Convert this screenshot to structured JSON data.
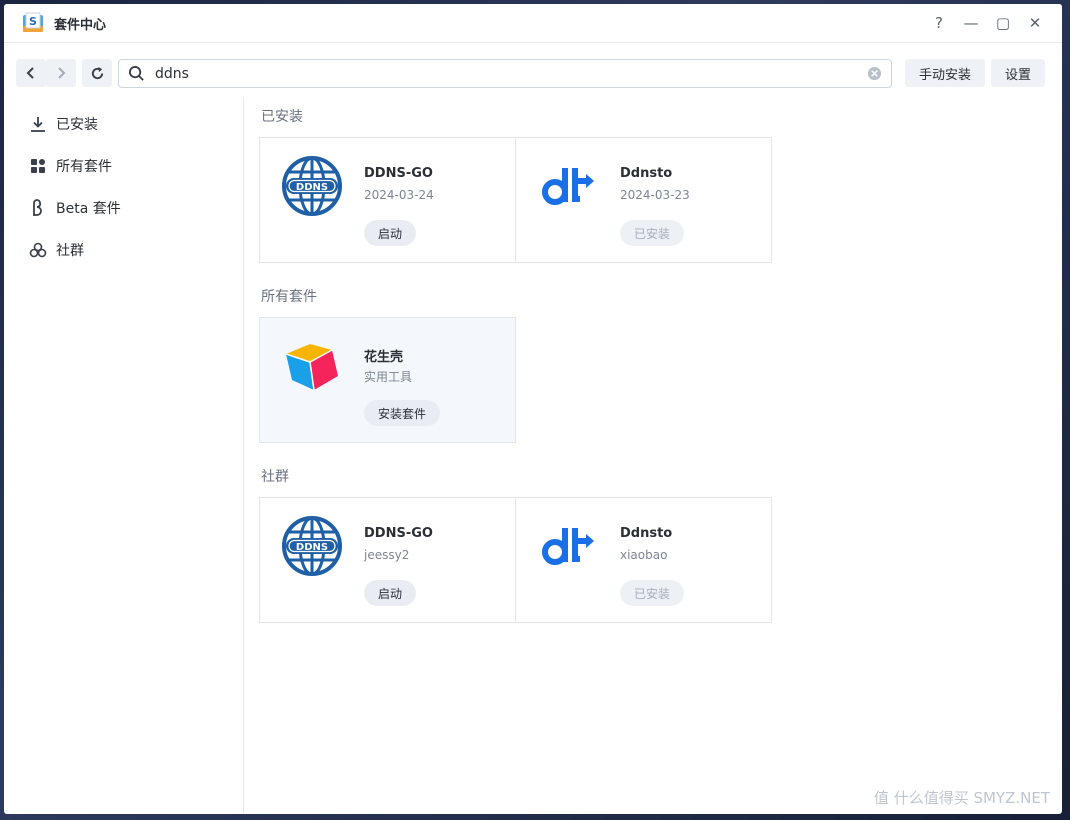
{
  "window": {
    "title": "套件中心"
  },
  "title_controls": {
    "help": "?",
    "minimize": "—",
    "maximize": "▢",
    "close": "✕"
  },
  "toolbar": {
    "search_value": "ddns",
    "manual_install_label": "手动安装",
    "settings_label": "设置"
  },
  "sidebar": {
    "items": [
      {
        "label": "已安装",
        "icon": "download-icon"
      },
      {
        "label": "所有套件",
        "icon": "grid-icon"
      },
      {
        "label": "Beta 套件",
        "icon": "beta-icon"
      },
      {
        "label": "社群",
        "icon": "community-icon"
      }
    ]
  },
  "sections": {
    "installed": {
      "title": "已安装",
      "cards": [
        {
          "name": "DDNS-GO",
          "sub": "2024-03-24",
          "action": "启动",
          "logo": "ddns-globe-logo",
          "action_disabled": false
        },
        {
          "name": "Ddnsto",
          "sub": "2024-03-23",
          "action": "已安装",
          "logo": "dt-logo",
          "action_disabled": true
        }
      ]
    },
    "all": {
      "title": "所有套件",
      "cards": [
        {
          "name": "花生壳",
          "sub": "实用工具",
          "action": "安装套件",
          "logo": "cube-logo",
          "action_disabled": false
        }
      ]
    },
    "community": {
      "title": "社群",
      "cards": [
        {
          "name": "DDNS-GO",
          "sub": "jeessy2",
          "action": "启动",
          "logo": "ddns-globe-logo",
          "action_disabled": false
        },
        {
          "name": "Ddnsto",
          "sub": "xiaobao",
          "action": "已安装",
          "logo": "dt-logo",
          "action_disabled": true
        }
      ]
    }
  },
  "watermark": "值 什么值得买 SMYZ.NET",
  "colors": {
    "accent": "#1f5fa6",
    "dt_blue": "#1a6fe8",
    "border": "#e2e6ec"
  }
}
